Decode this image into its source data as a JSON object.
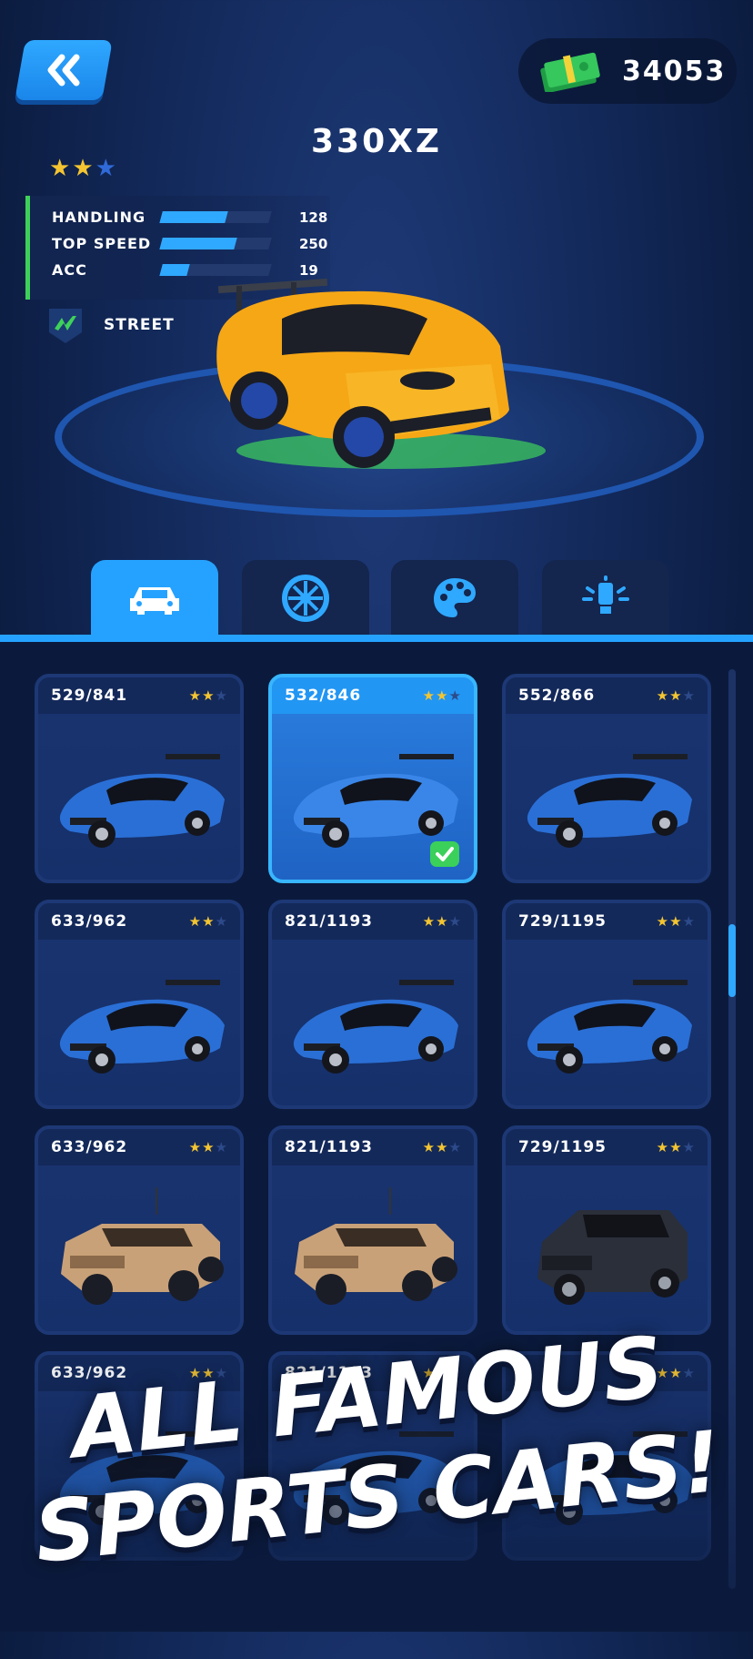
{
  "header": {
    "currency_value": "34053",
    "car_name": "330XZ",
    "rating": {
      "filled": 2,
      "total": 3
    }
  },
  "stats": [
    {
      "label": "HANDLING",
      "value": "128",
      "level": 0.6
    },
    {
      "label": "TOP SPEED",
      "value": "250",
      "level": 0.68
    },
    {
      "label": "ACC",
      "value": "19",
      "level": 0.25
    }
  ],
  "car_class": "STREET",
  "tabs": [
    {
      "name": "cars",
      "icon": "car-icon",
      "active": true
    },
    {
      "name": "wheels",
      "icon": "wheel-icon",
      "active": false
    },
    {
      "name": "paint",
      "icon": "palette-icon",
      "active": false
    },
    {
      "name": "lights",
      "icon": "light-icon",
      "active": false
    }
  ],
  "cars": [
    {
      "price": "529/841",
      "stars": 2,
      "selected": false,
      "color": "#2a6fd6",
      "type": "sport"
    },
    {
      "price": "532/846",
      "stars": 2,
      "selected": true,
      "color": "#3a86e8",
      "type": "sport"
    },
    {
      "price": "552/866",
      "stars": 2,
      "selected": false,
      "color": "#2a6fd6",
      "type": "sport"
    },
    {
      "price": "633/962",
      "stars": 2,
      "selected": false,
      "color": "#2a6fd6",
      "type": "sport"
    },
    {
      "price": "821/1193",
      "stars": 2,
      "selected": false,
      "color": "#2a6fd6",
      "type": "sport"
    },
    {
      "price": "729/1195",
      "stars": 2,
      "selected": false,
      "color": "#2a6fd6",
      "type": "sport"
    },
    {
      "price": "633/962",
      "stars": 2,
      "selected": false,
      "color": "#c9a178",
      "type": "hummer"
    },
    {
      "price": "821/1193",
      "stars": 2,
      "selected": false,
      "color": "#c9a178",
      "type": "hummer"
    },
    {
      "price": "729/1195",
      "stars": 2,
      "selected": false,
      "color": "#2b2f3a",
      "type": "suv"
    },
    {
      "price": "633/962",
      "stars": 2,
      "selected": false,
      "color": "#2a6fd6",
      "type": "sport"
    },
    {
      "price": "821/1193",
      "stars": 2,
      "selected": false,
      "color": "#2a6fd6",
      "type": "sport"
    },
    {
      "price": "",
      "stars": 2,
      "selected": false,
      "color": "#2a6fd6",
      "type": "sport"
    }
  ],
  "promo": {
    "line1": "ALL FAMOUS",
    "line2": "SPORTS CARS!"
  },
  "colors": {
    "accent": "#25a2ff",
    "star": "#f4c531",
    "class_green": "#3ed15a",
    "hero_car": "#f6a716"
  }
}
